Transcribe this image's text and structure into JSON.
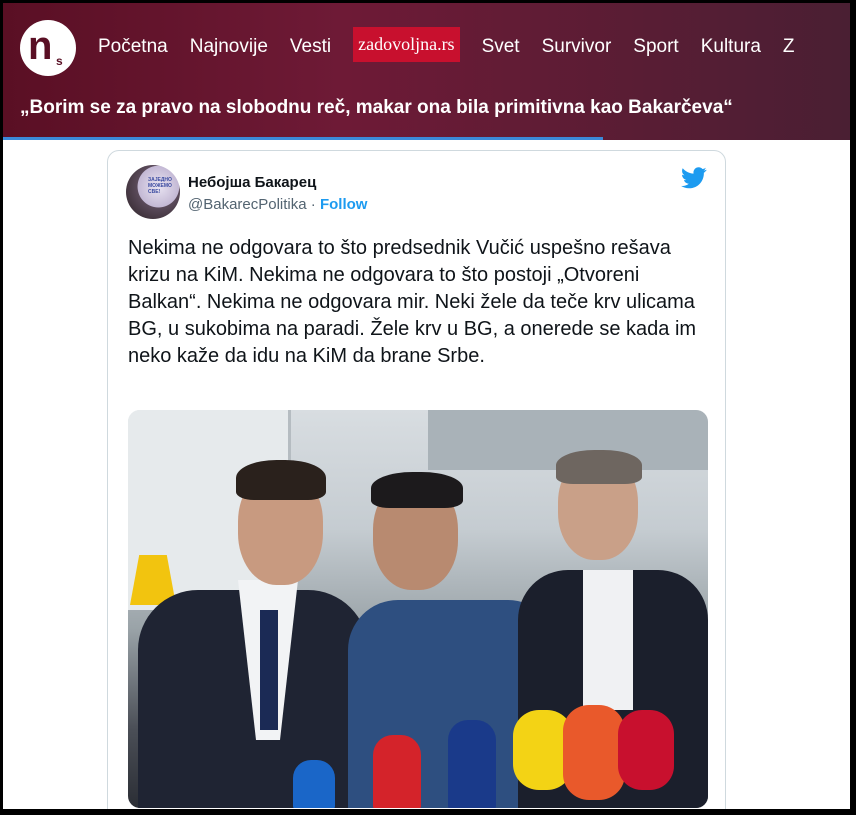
{
  "nav": {
    "items": [
      "Početna",
      "Najnovije",
      "Vesti"
    ],
    "special": "zadovoljna.rs",
    "items_after": [
      "Svet",
      "Survivor",
      "Sport",
      "Kultura",
      "Z"
    ]
  },
  "headline": "„Borim se za pravo na slobodnu reč, makar ona bila primitivna kao Bakarčeva“",
  "tweet": {
    "name": "Небојша Бакарец",
    "handle": "@BakarecPolitika",
    "separator": " · ",
    "follow": "Follow",
    "text": "Nekima ne odgovara to što predsednik Vučić uspešno rešava krizu na KiM. Nekima ne odgovara to što postoji „Otvoreni Balkan“. Nekima ne odgovara mir. Neki žele da teče krv ulicama BG, u sukobima na paradi. Žele krv u BG, a onerede se kada im neko kaže da idu na KiM da brane Srbe.",
    "avatar_text": "ЗАЈЕДНО МОЖЕМО СВЕ!"
  },
  "colors": {
    "header": "#5a0f24",
    "accent": "#1d9bf0",
    "special": "#c8102e"
  }
}
